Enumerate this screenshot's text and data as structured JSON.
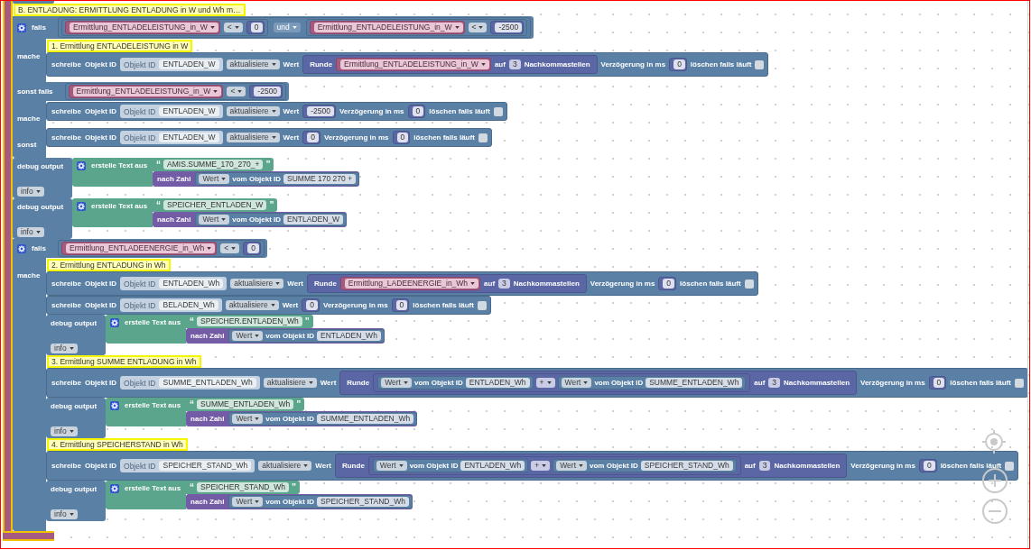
{
  "workspace": {
    "container": {
      "selected": true,
      "statements": [
        {
          "kind": "if",
          "comment": "B. ENTLADUNG: ERMITTLUNG ENTLADUNG in W und Wh m…",
          "mutator": true,
          "clauses": [
            {
              "kind": "condition",
              "label": "falls",
              "input": {
                "kind": "logic_op",
                "op": "und",
                "left": {
                  "kind": "compare",
                  "op": "<",
                  "left": {
                    "kind": "variable",
                    "name": "Ermittlung_ENTLADELEISTUNG_in_W"
                  },
                  "right": {
                    "kind": "number",
                    "value": "0"
                  }
                },
                "right": {
                  "kind": "compare",
                  "op": "<",
                  "left": {
                    "kind": "variable",
                    "name": "Ermittlung_ENTLADELEISTUNG_in_W"
                  },
                  "right": {
                    "kind": "number",
                    "value": "-2500"
                  }
                }
              }
            },
            {
              "kind": "body",
              "label": "mache",
              "statements": [
                {
                  "kind": "write",
                  "comment": "1. Ermittlung ENTLADELEISTUNG in W",
                  "label": "schreibe",
                  "id_label": "Objekt ID",
                  "object": {
                    "kind": "object_id",
                    "label": "Objekt ID",
                    "value": "ENTLADEN_W"
                  },
                  "mode": "aktualisiere",
                  "value_label": "Wert",
                  "value": {
                    "kind": "round",
                    "label": "Runde",
                    "value": {
                      "kind": "variable",
                      "name": "Ermittlung_ENTLADELEISTUNG_in_W"
                    },
                    "digits_label": "auf",
                    "digits": "3",
                    "suffix": "Nachkommastellen"
                  },
                  "delay_label": "Verzögerung in ms",
                  "delay": {
                    "kind": "number",
                    "value": "0"
                  },
                  "clear_label": "löschen falls läuft",
                  "clear_checked": false
                }
              ]
            },
            {
              "kind": "condition",
              "label": "sonst falls",
              "input": {
                "kind": "compare",
                "op": "<",
                "left": {
                  "kind": "variable",
                  "name": "Ermittlung_ENTLADELEISTUNG_in_W"
                },
                "right": {
                  "kind": "number",
                  "value": "-2500"
                }
              }
            },
            {
              "kind": "body",
              "label": "mache",
              "statements": [
                {
                  "kind": "write",
                  "label": "schreibe",
                  "id_label": "Objekt ID",
                  "object": {
                    "kind": "object_id",
                    "label": "Objekt ID",
                    "value": "ENTLADEN_W"
                  },
                  "mode": "aktualisiere",
                  "value_label": "Wert",
                  "value": {
                    "kind": "number",
                    "value": "-2500"
                  },
                  "delay_label": "Verzögerung in ms",
                  "delay": {
                    "kind": "number",
                    "value": "0"
                  },
                  "clear_label": "löschen falls läuft",
                  "clear_checked": false
                }
              ]
            },
            {
              "kind": "body",
              "label": "sonst",
              "statements": [
                {
                  "kind": "write",
                  "label": "schreibe",
                  "id_label": "Objekt ID",
                  "object": {
                    "kind": "object_id",
                    "label": "Objekt ID",
                    "value": "ENTLADEN_W"
                  },
                  "mode": "aktualisiere",
                  "value_label": "Wert",
                  "value": {
                    "kind": "number",
                    "value": "0"
                  },
                  "delay_label": "Verzögerung in ms",
                  "delay": {
                    "kind": "number",
                    "value": "0"
                  },
                  "clear_label": "löschen falls läuft",
                  "clear_checked": false
                }
              ]
            }
          ]
        },
        {
          "kind": "debug",
          "label": "debug output",
          "level": "info",
          "value": {
            "kind": "text_join",
            "mutator": true,
            "label": "erstelle Text aus",
            "items": [
              {
                "kind": "text",
                "open": "“",
                "value": "AMIS.SUMME_170_270_+",
                "close": "”"
              },
              {
                "kind": "to_number",
                "label": "nach Zahl",
                "value": {
                  "kind": "get_state",
                  "attribute": "Wert",
                  "label": "vom Objekt ID",
                  "object": "SUMME 170 270 +"
                }
              }
            ]
          }
        },
        {
          "kind": "debug",
          "label": "debug output",
          "level": "info",
          "value": {
            "kind": "text_join",
            "mutator": true,
            "label": "erstelle Text aus",
            "items": [
              {
                "kind": "text",
                "open": "“",
                "value": "SPEICHER_ENTLADEN_W",
                "close": "”"
              },
              {
                "kind": "to_number",
                "label": "nach Zahl",
                "value": {
                  "kind": "get_state",
                  "attribute": "Wert",
                  "label": "vom Objekt ID",
                  "object": "ENTLADEN_W"
                }
              }
            ]
          }
        },
        {
          "kind": "if",
          "mutator": true,
          "clauses": [
            {
              "kind": "condition",
              "label": "falls",
              "input": {
                "kind": "compare",
                "op": "<",
                "left": {
                  "kind": "variable",
                  "name": "Ermittlung_ENTLADEENERGIE_in_Wh"
                },
                "right": {
                  "kind": "number",
                  "value": "0"
                }
              }
            },
            {
              "kind": "body",
              "label": "mache",
              "statements": [
                {
                  "kind": "write",
                  "comment": "2. Ermittlung ENTLADUNG in Wh",
                  "label": "schreibe",
                  "id_label": "Objekt ID",
                  "object": {
                    "kind": "object_id",
                    "label": "Objekt ID",
                    "value": "ENTLADEN_Wh"
                  },
                  "mode": "aktualisiere",
                  "value_label": "Wert",
                  "value": {
                    "kind": "round",
                    "label": "Runde",
                    "value": {
                      "kind": "variable",
                      "name": "Ermittlung_LADEENERGIE_in_Wh"
                    },
                    "digits_label": "auf",
                    "digits": "3",
                    "suffix": "Nachkommastellen"
                  },
                  "delay_label": "Verzögerung in ms",
                  "delay": {
                    "kind": "number",
                    "value": "0"
                  },
                  "clear_label": "löschen falls läuft",
                  "clear_checked": false
                },
                {
                  "kind": "write",
                  "label": "schreibe",
                  "id_label": "Objekt ID",
                  "object": {
                    "kind": "object_id",
                    "label": "Objekt ID",
                    "value": "BELADEN_Wh"
                  },
                  "mode": "aktualisiere",
                  "value_label": "Wert",
                  "value": {
                    "kind": "number",
                    "value": "0"
                  },
                  "delay_label": "Verzögerung in ms",
                  "delay": {
                    "kind": "number",
                    "value": "0"
                  },
                  "clear_label": "löschen falls läuft",
                  "clear_checked": false
                },
                {
                  "kind": "debug",
                  "label": "debug output",
                  "level": "info",
                  "value": {
                    "kind": "text_join",
                    "mutator": true,
                    "label": "erstelle Text aus",
                    "items": [
                      {
                        "kind": "text",
                        "open": "“",
                        "value": "SPEICHER.ENTLADEN_Wh",
                        "close": "”"
                      },
                      {
                        "kind": "to_number",
                        "label": "nach Zahl",
                        "value": {
                          "kind": "get_state",
                          "attribute": "Wert",
                          "label": "vom Objekt ID",
                          "object": "ENTLADEN_Wh"
                        }
                      }
                    ]
                  }
                },
                {
                  "kind": "write",
                  "comment": "3. Ermittlung SUMME ENTLADUNG in Wh",
                  "label": "schreibe",
                  "id_label": "Objekt ID",
                  "object": {
                    "kind": "object_id",
                    "label": "Objekt ID",
                    "value": "SUMME_ENTLADEN_Wh"
                  },
                  "mode": "aktualisiere",
                  "value_label": "Wert",
                  "value": {
                    "kind": "round",
                    "label": "Runde",
                    "value": {
                      "kind": "arithmetic",
                      "op": "+",
                      "left": {
                        "kind": "get_state",
                        "attribute": "Wert",
                        "label": "vom Objekt ID",
                        "object": "ENTLADEN_Wh"
                      },
                      "right": {
                        "kind": "get_state",
                        "attribute": "Wert",
                        "label": "vom Objekt ID",
                        "object": "SUMME_ENTLADEN_Wh"
                      }
                    },
                    "digits_label": "auf",
                    "digits": "3",
                    "suffix": "Nachkommastellen"
                  },
                  "delay_label": "Verzögerung in ms",
                  "delay": {
                    "kind": "number",
                    "value": "0"
                  },
                  "clear_label": "löschen falls läuft",
                  "clear_checked": false
                },
                {
                  "kind": "debug",
                  "label": "debug output",
                  "level": "info",
                  "value": {
                    "kind": "text_join",
                    "mutator": true,
                    "label": "erstelle Text aus",
                    "items": [
                      {
                        "kind": "text",
                        "open": "“",
                        "value": "SUMME_ENTLADEN_Wh",
                        "close": "”"
                      },
                      {
                        "kind": "to_number",
                        "label": "nach Zahl",
                        "value": {
                          "kind": "get_state",
                          "attribute": "Wert",
                          "label": "vom Objekt ID",
                          "object": "SUMME_ENTLADEN_Wh"
                        }
                      }
                    ]
                  }
                },
                {
                  "kind": "write",
                  "comment": "4. Ermittlung SPEICHERSTAND in Wh",
                  "label": "schreibe",
                  "id_label": "Objekt ID",
                  "object": {
                    "kind": "object_id",
                    "label": "Objekt ID",
                    "value": "SPEICHER_STAND_Wh"
                  },
                  "mode": "aktualisiere",
                  "value_label": "Wert",
                  "value": {
                    "kind": "round",
                    "label": "Runde",
                    "value": {
                      "kind": "arithmetic",
                      "op": "+",
                      "left": {
                        "kind": "get_state",
                        "attribute": "Wert",
                        "label": "vom Objekt ID",
                        "object": "ENTLADEN_Wh"
                      },
                      "right": {
                        "kind": "get_state",
                        "attribute": "Wert",
                        "label": "vom Objekt ID",
                        "object": "SPEICHER_STAND_Wh"
                      }
                    },
                    "digits_label": "auf",
                    "digits": "3",
                    "suffix": "Nachkommastellen"
                  },
                  "delay_label": "Verzögerung in ms",
                  "delay": {
                    "kind": "number",
                    "value": "0"
                  },
                  "clear_label": "löschen falls läuft",
                  "clear_checked": false
                },
                {
                  "kind": "debug",
                  "label": "debug output",
                  "level": "info",
                  "value": {
                    "kind": "text_join",
                    "mutator": true,
                    "label": "erstelle Text aus",
                    "items": [
                      {
                        "kind": "text",
                        "open": "“",
                        "value": "SPEICHER_STAND_Wh",
                        "close": "”"
                      },
                      {
                        "kind": "to_number",
                        "label": "nach Zahl",
                        "value": {
                          "kind": "get_state",
                          "attribute": "Wert",
                          "label": "vom Objekt ID",
                          "object": "SPEICHER_STAND_Wh"
                        }
                      }
                    ]
                  }
                }
              ]
            }
          ]
        }
      ]
    }
  }
}
